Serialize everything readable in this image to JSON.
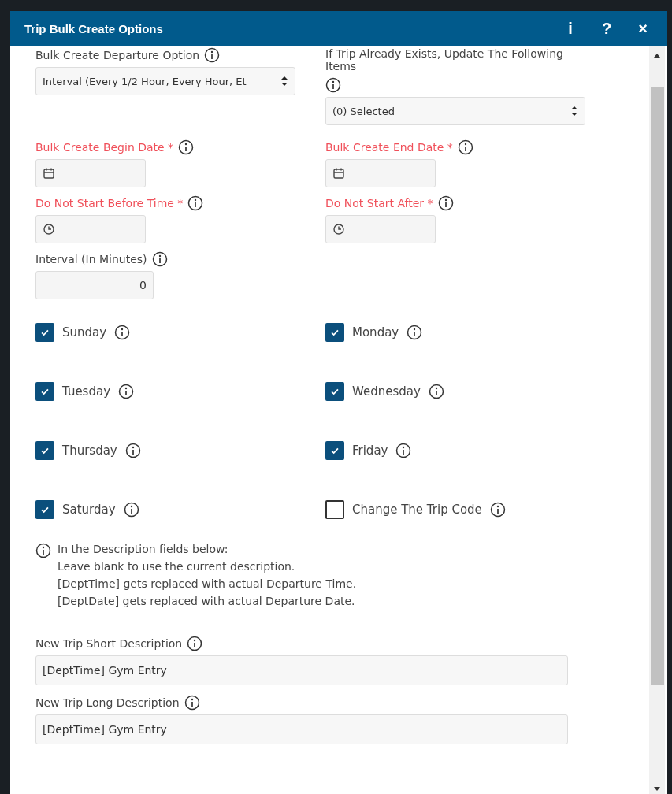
{
  "window": {
    "title": "Trip Bulk Create Options",
    "buttons": [
      "i",
      "?",
      "×"
    ]
  },
  "selects": [
    {
      "label": "Bulk Create Departure Option",
      "value": "Interval (Every 1/2 Hour, Every Hour, Et"
    },
    {
      "label": "If Trip Already Exists, Update The Following Items",
      "value": "(0) Selected"
    }
  ],
  "pickers": [
    {
      "kind": "date",
      "label": "Bulk Create Begin Date *",
      "required": true
    },
    {
      "kind": "date",
      "label": "Bulk Create End Date *",
      "required": true
    },
    {
      "kind": "time",
      "label": "Do Not Start Before Time *",
      "required": true
    },
    {
      "kind": "time",
      "label": "Do Not Start After *",
      "required": true
    }
  ],
  "interval": {
    "label": "Interval (In Minutes)",
    "value": "0"
  },
  "checkboxes": [
    {
      "label": "Sunday",
      "checked": true
    },
    {
      "label": "Monday",
      "checked": true
    },
    {
      "label": "Tuesday",
      "checked": true
    },
    {
      "label": "Wednesday",
      "checked": true
    },
    {
      "label": "Thursday",
      "checked": true
    },
    {
      "label": "Friday",
      "checked": true
    },
    {
      "label": "Saturday",
      "checked": true
    },
    {
      "label": "Change The Trip Code",
      "checked": false
    }
  ],
  "note": [
    "In the Description fields below:",
    "Leave blank to use the current description.",
    "[DeptTime] gets replaced with actual Departure Time.",
    "[DeptDate] gets replaced with actual Departure Date."
  ],
  "descriptions": [
    {
      "label": "New Trip Short Description",
      "value": "[DeptTime] Gym Entry"
    },
    {
      "label": "New Trip Long Description",
      "value": "[DeptTime] Gym Entry"
    }
  ]
}
